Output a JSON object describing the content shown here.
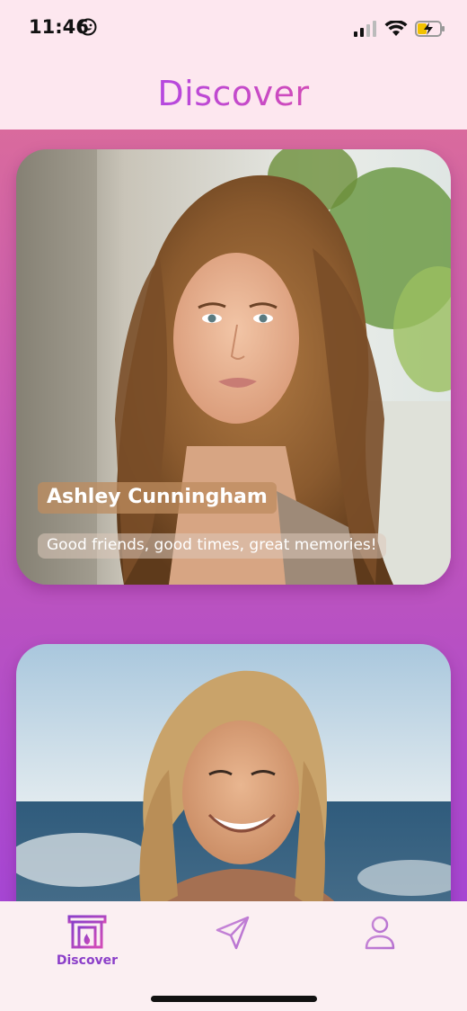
{
  "status_bar": {
    "time": "11:46",
    "emoji_icon": "smiley-icon",
    "signal_icon": "signal-bars-icon",
    "wifi_icon": "wifi-icon",
    "battery_icon": "battery-charging-icon"
  },
  "header": {
    "title": "Discover"
  },
  "feed": {
    "cards": [
      {
        "name": "Ashley Cunningham",
        "bio": "Good friends, good times, great memories!"
      },
      {
        "name": "",
        "bio": ""
      }
    ]
  },
  "tab_bar": {
    "tabs": [
      {
        "label": "Discover",
        "icon": "fireplace-icon",
        "active": true
      },
      {
        "label": "",
        "icon": "send-icon",
        "active": false
      },
      {
        "label": "",
        "icon": "person-icon",
        "active": false
      }
    ],
    "active_color": "#8b3fc9",
    "accent_color": "#d14bb8"
  }
}
